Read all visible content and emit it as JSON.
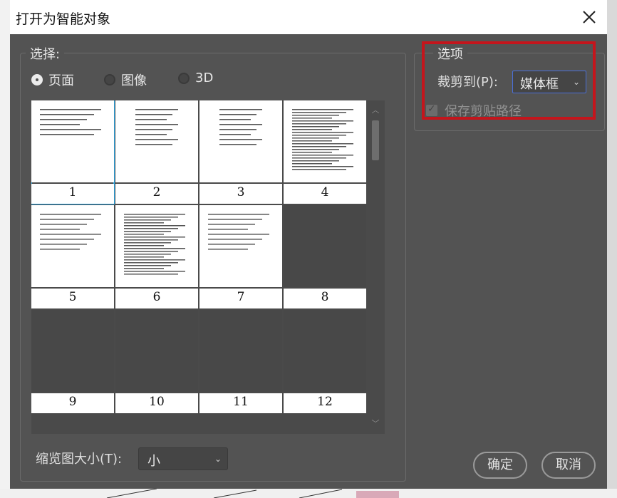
{
  "dialog": {
    "title": "打开为智能对象",
    "close_icon": "close-icon"
  },
  "select_group": {
    "legend": "选择:",
    "radios": [
      {
        "label": "页面",
        "checked": true
      },
      {
        "label": "图像",
        "checked": false
      },
      {
        "label": "3D",
        "checked": false
      }
    ],
    "pages": [
      {
        "num": "1",
        "has_content": true,
        "selected": true
      },
      {
        "num": "2",
        "has_content": true,
        "selected": false
      },
      {
        "num": "3",
        "has_content": true,
        "selected": false
      },
      {
        "num": "4",
        "has_content": true,
        "selected": false
      },
      {
        "num": "5",
        "has_content": true,
        "selected": false
      },
      {
        "num": "6",
        "has_content": true,
        "selected": false
      },
      {
        "num": "7",
        "has_content": true,
        "selected": false
      },
      {
        "num": "8",
        "has_content": false,
        "selected": false
      },
      {
        "num": "9",
        "has_content": false,
        "selected": false
      },
      {
        "num": "10",
        "has_content": false,
        "selected": false
      },
      {
        "num": "11",
        "has_content": false,
        "selected": false
      },
      {
        "num": "12",
        "has_content": false,
        "selected": false
      }
    ],
    "thumb_size_label": "缩览图大小(T):",
    "thumb_size_value": "小"
  },
  "options_group": {
    "legend": "选项",
    "crop_label": "裁剪到(P):",
    "crop_value": "媒体框",
    "keep_clip_path_label": "保存剪贴路径",
    "keep_clip_path_checked": true
  },
  "buttons": {
    "ok": "确定",
    "cancel": "取消"
  },
  "colors": {
    "dialog_bg": "#535353",
    "selection": "#2aa4e0",
    "highlight": "#c4151c"
  }
}
